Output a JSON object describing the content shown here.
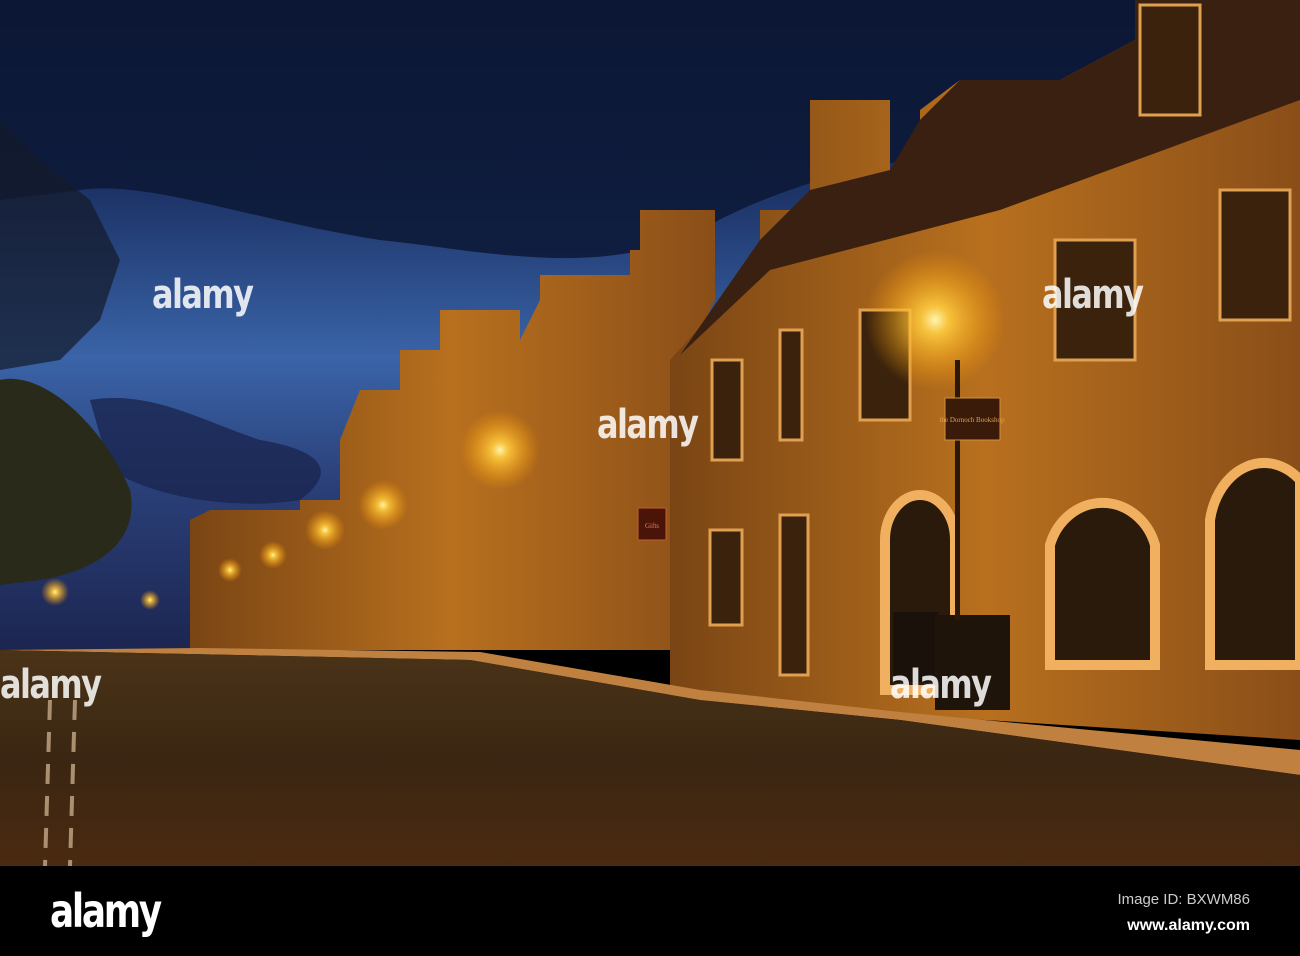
{
  "photo": {
    "subject": "Night street with lit stone buildings",
    "shop_sign": "the Dornoch Bookshop",
    "gift_sign": "Gifts"
  },
  "watermark": {
    "text": "alamy"
  },
  "footer": {
    "logo": "alamy",
    "image_id": "Image ID: BXWM86",
    "url": "www.alamy.com"
  },
  "colors": {
    "sky_top": "#0d1a3e",
    "sky_low": "#3d6ab0",
    "lamp": "#ffd060",
    "stone": "#9a5a1c",
    "road": "#3a2410"
  }
}
